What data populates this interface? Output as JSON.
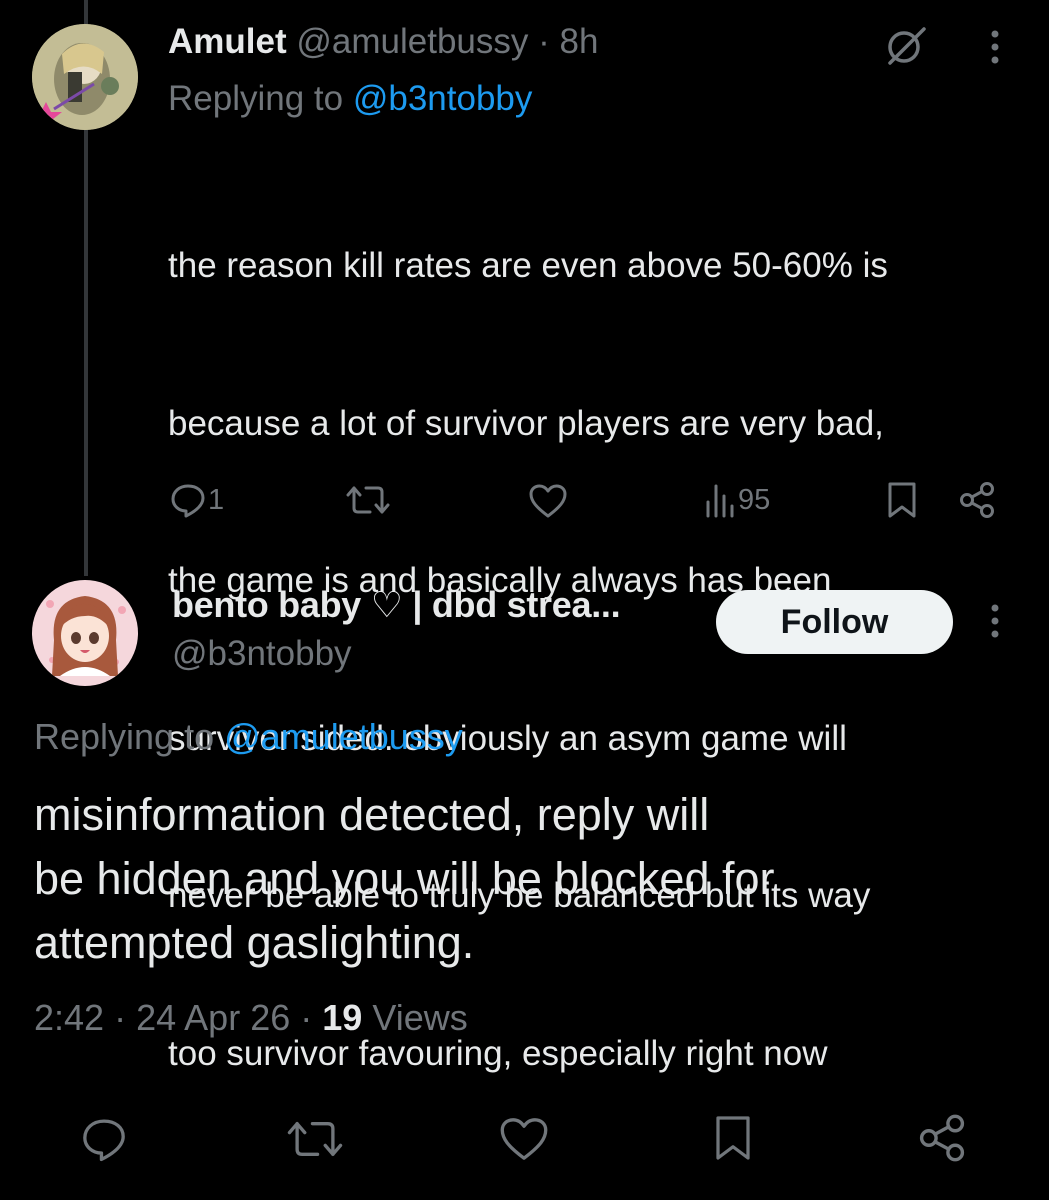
{
  "reply_tweet": {
    "display_name": "Amulet",
    "handle": "@amuletbussy",
    "separator": "·",
    "time": "8h",
    "replying_prefix": "Replying to",
    "replying_to": "@b3ntobby",
    "text_lines": [
      "the reason kill rates are even above 50-60% is",
      "because a lot of survivor players are very bad,",
      "the game is and basically always has been",
      "survivor sided. obviously an asym game will",
      "never be able to truly be balanced but its way",
      "too survivor favouring, especially right now"
    ],
    "reply_count": "1",
    "views_count": "95",
    "icons": {
      "grok": "grok-icon",
      "more": "more-icon",
      "reply": "reply-icon",
      "retweet": "retweet-icon",
      "like": "like-icon",
      "views": "views-icon",
      "bookmark": "bookmark-icon",
      "share": "share-icon"
    }
  },
  "main_tweet": {
    "display_name": "bento baby ♡ | dbd strea...",
    "handle": "@b3ntobby",
    "follow_label": "Follow",
    "replying_prefix": "Replying to",
    "replying_to": "@amuletbussy",
    "text_lines": [
      "misinformation detected, reply will",
      "be hidden and you will be blocked for",
      "attempted gaslighting."
    ],
    "time": "2:42",
    "date": "24 Apr 26",
    "separator": "·",
    "views_count": "19",
    "views_label": "Views"
  },
  "colors": {
    "background": "#000000",
    "text": "#e7e9ea",
    "muted": "#71767b",
    "link": "#1d9bf0",
    "follow_bg": "#eff3f4"
  }
}
